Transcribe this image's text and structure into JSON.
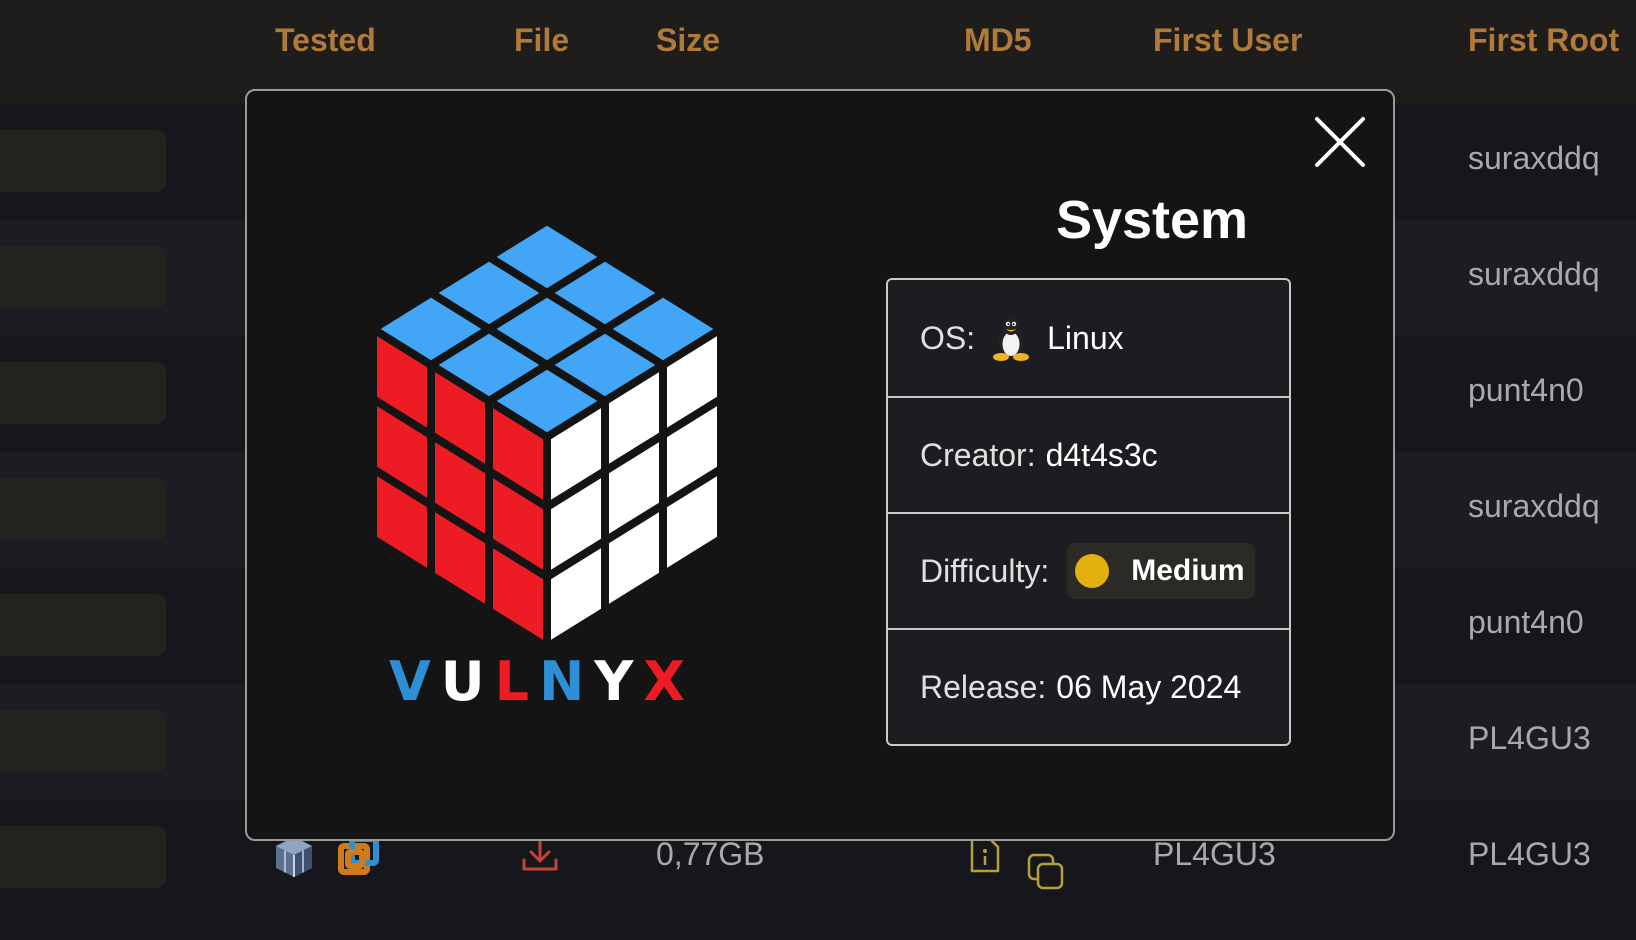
{
  "table": {
    "headers": [
      "Tested",
      "File",
      "Size",
      "MD5",
      "First User",
      "First Root"
    ],
    "first_root_values": [
      "suraxddq",
      "suraxddq",
      "punt4n0",
      "suraxddq",
      "punt4n0",
      "PL4GU3",
      "PL4GU3"
    ],
    "bottom_row": {
      "size": "0,77GB",
      "first_user": "PL4GU3"
    }
  },
  "modal": {
    "title": "System",
    "logo_text": "VULNYX",
    "os_label": "OS:",
    "os_value": "Linux",
    "os_icon": "tux-penguin-icon",
    "creator_label": "Creator:",
    "creator_value": "d4t4s3c",
    "difficulty_label": "Difficulty:",
    "difficulty_value": "Medium",
    "difficulty_color": "#e2b10f",
    "release_label": "Release:",
    "release_value": "06 May 2024"
  },
  "colors": {
    "accent_header": "#b07a3a",
    "cube_top": "#42a5f5",
    "cube_left": "#ed1c24",
    "cube_right": "#ffffff"
  }
}
